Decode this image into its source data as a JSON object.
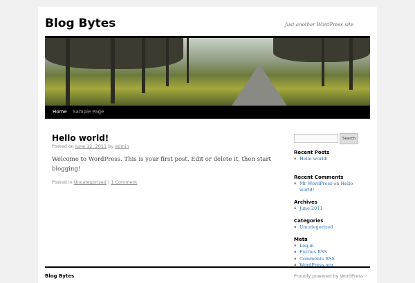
{
  "site": {
    "title": "Blog Bytes",
    "tagline": "Just another WordPress site"
  },
  "nav": {
    "items": [
      "Home",
      "Sample Page"
    ]
  },
  "post": {
    "title": "Hello world!",
    "posted_on": "Posted on",
    "date": "June 12, 2011",
    "by": "by",
    "author": "admin",
    "body": "Welcome to WordPress. This is your first post. Edit or delete it, then start blogging!",
    "posted_in": "Posted in",
    "category": "Uncategorized",
    "sep": "|",
    "comments": "1 Comment"
  },
  "sidebar": {
    "search_button": "Search",
    "recent_posts": {
      "title": "Recent Posts",
      "items": [
        "Hello world!"
      ]
    },
    "recent_comments": {
      "title": "Recent Comments",
      "author": "Mr WordPress",
      "on": "on",
      "post": "Hello world!"
    },
    "archives": {
      "title": "Archives",
      "items": [
        "June 2011"
      ]
    },
    "categories": {
      "title": "Categories",
      "items": [
        "Uncategorized"
      ]
    },
    "meta": {
      "title": "Meta",
      "items": [
        "Log in",
        "Entries RSS",
        "Comments RSS",
        "WordPress.org"
      ]
    }
  },
  "footer": {
    "title": "Blog Bytes",
    "powered": "Proudly powered by WordPress"
  }
}
